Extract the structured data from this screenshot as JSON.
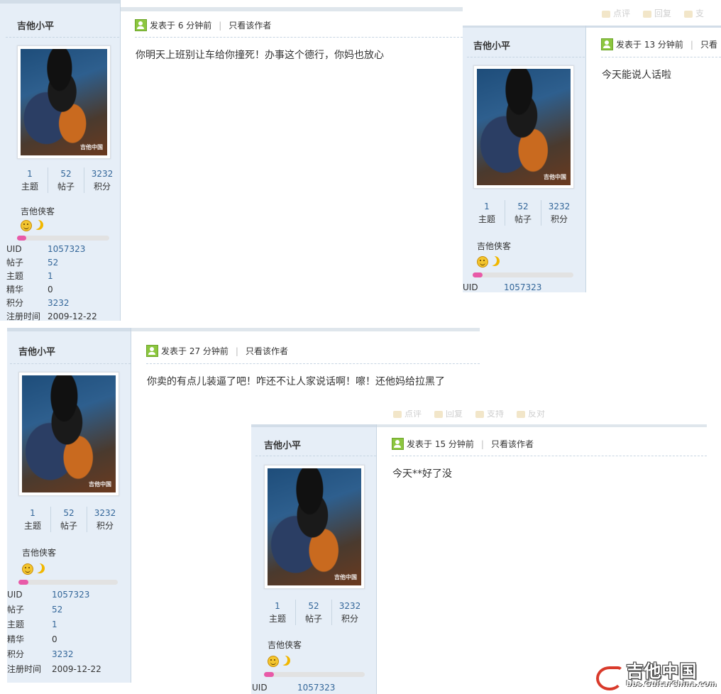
{
  "user": {
    "name": "吉他小平",
    "avatar_watermark": "吉他中国",
    "stats": [
      {
        "value": "1",
        "label": "主题"
      },
      {
        "value": "52",
        "label": "帖子"
      },
      {
        "value": "3232",
        "label": "积分"
      }
    ],
    "rank": "吉他侠客",
    "level_progress": 0.1,
    "info_rows": [
      {
        "key": "UID",
        "value": "1057323"
      },
      {
        "key": "帖子",
        "value": "52"
      },
      {
        "key": "主题",
        "value": "1"
      },
      {
        "key": "精华",
        "value": "0"
      },
      {
        "key": "积分",
        "value": "3232"
      },
      {
        "key": "注册时间",
        "value": "2009-12-22"
      }
    ]
  },
  "post_header": {
    "author_only": "只看该作者"
  },
  "posts": [
    {
      "time": "发表于 6 分钟前",
      "content": "你明天上班别让车给你撞死！办事这个德行，你妈也放心"
    },
    {
      "time": "发表于 13 分钟前",
      "author_only_partial": "只看",
      "content": "今天能说人话啦"
    },
    {
      "time": "发表于 27 分钟前",
      "content": "你卖的有点儿装逼了吧！咋还不让人家说话啊！嚓！还他妈给拉黑了"
    },
    {
      "time": "发表于 15 分钟前",
      "content": "今天**好了没"
    }
  ],
  "ghost_actions_right": [
    "点评",
    "回复",
    "支"
  ],
  "ghost_actions_bottom": [
    "点评",
    "回复",
    "支持",
    "反对"
  ],
  "logo": {
    "cn": "吉他中国",
    "en": "bbs.GuitarChina.com"
  }
}
